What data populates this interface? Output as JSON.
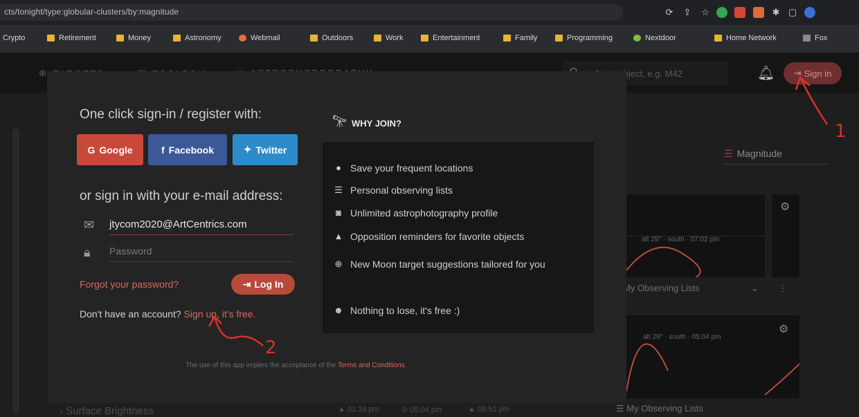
{
  "browser": {
    "url": "cts/tonight/type:globular-clusters/by:magnitude",
    "bookmarks": [
      "Crypto",
      "Retirement",
      "Money",
      "Astronomy",
      "Webmail",
      "Outdoors",
      "Work",
      "Entertainment",
      "Family",
      "Programming",
      "Nextdoor",
      "Home Network",
      "Fox"
    ]
  },
  "app": {
    "nav": [
      "TARGETS",
      "TOOLBOX",
      "ASTROPHOTOGRAPHY"
    ],
    "search_placeholder": "Go to object, e.g. M42",
    "signin_label": "Sign in",
    "sort_label": "Magnitude",
    "card1_caption": "alt 29° · south · 07:02 pm",
    "card2_caption": "alt 29° · south · 05:04 pm",
    "observing_lists_1": "My Observing Lists",
    "observing_lists_2": "My Observing Lists",
    "surface_brightness": "Surface Brightness",
    "bottom_times": [
      "01:16 pm",
      "05:04 pm",
      "08:51 pm"
    ]
  },
  "modal": {
    "social_heading": "One click sign-in / register with:",
    "google": "Google",
    "facebook": "Facebook",
    "twitter": "Twitter",
    "email_heading": "or sign in with your e-mail address:",
    "email_value": "jtycom2020@ArtCentrics.com",
    "password_placeholder": "Password",
    "forgot": "Forgot your password?",
    "login": "Log In",
    "no_account": "Don't have an account?",
    "signup": "Sign up, it's free.",
    "terms_prefix": "The use of this app implies the acceptance of the",
    "terms_link": "Terms and Conditions",
    "terms_suffix": "."
  },
  "why": {
    "title": "WHY JOIN?",
    "items": [
      "Save your frequent locations",
      "Personal observing lists",
      "Unlimited astrophotography profile",
      "Opposition reminders for favorite objects",
      "New Moon target suggestions tailored for you",
      "Nothing to lose, it's free :)"
    ]
  },
  "annotations": {
    "one": "1",
    "two": "2"
  },
  "colors": {
    "accent": "#b84a3c",
    "google": "#c8493a",
    "facebook": "#3b5998",
    "twitter": "#2e8bc9"
  }
}
